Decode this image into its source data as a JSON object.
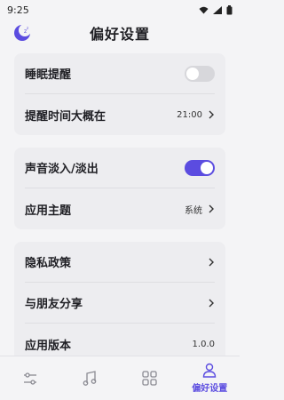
{
  "status_bar": {
    "time": "9:25",
    "icons": [
      "wifi-icon",
      "signal-icon",
      "battery-icon"
    ]
  },
  "header": {
    "title": "偏好设置",
    "logo_icon": "moon-logo-icon"
  },
  "sections": {
    "sleep": {
      "reminder_label": "睡眠提醒",
      "reminder_enabled": false,
      "time_label": "提醒时间大概在",
      "time_value": "21:00"
    },
    "audio": {
      "fade_label": "声音淡入/淡出",
      "fade_enabled": true,
      "theme_label": "应用主题",
      "theme_value": "系统"
    },
    "about": {
      "privacy_label": "隐私政策",
      "share_label": "与朋友分享",
      "version_label": "应用版本",
      "version_value": "1.0.0"
    }
  },
  "bottom_nav": {
    "items": [
      {
        "icon": "sliders-icon",
        "label": ""
      },
      {
        "icon": "music-note-icon",
        "label": ""
      },
      {
        "icon": "grid-icon",
        "label": ""
      },
      {
        "icon": "user-icon",
        "label": "偏好设置",
        "active": true
      }
    ]
  },
  "colors": {
    "accent": "#5b4ce0",
    "background": "#f4f4f6",
    "card": "#ededf0"
  }
}
